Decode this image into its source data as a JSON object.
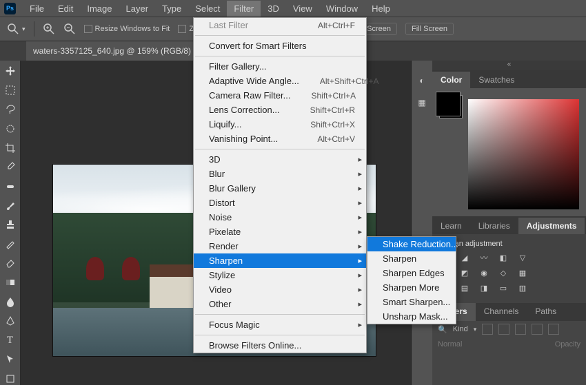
{
  "menubar": {
    "items": [
      "File",
      "Edit",
      "Image",
      "Layer",
      "Type",
      "Select",
      "Filter",
      "3D",
      "View",
      "Window",
      "Help"
    ],
    "active": "Filter"
  },
  "optionsBar": {
    "resizeWindows": "Resize Windows to Fit",
    "zoomAll": "Z",
    "fitScreen": "Screen",
    "fillScreen": "Fill Screen"
  },
  "document": {
    "tabTitle": "waters-3357125_640.jpg @ 159% (RGB/8)"
  },
  "filterMenu": {
    "lastFilter": {
      "label": "Last Filter",
      "shortcut": "Alt+Ctrl+F"
    },
    "convertSmart": "Convert for Smart Filters",
    "gallery": "Filter Gallery...",
    "adaptive": {
      "label": "Adaptive Wide Angle...",
      "shortcut": "Alt+Shift+Ctrl+A"
    },
    "cameraRaw": {
      "label": "Camera Raw Filter...",
      "shortcut": "Shift+Ctrl+A"
    },
    "lens": {
      "label": "Lens Correction...",
      "shortcut": "Shift+Ctrl+R"
    },
    "liquify": {
      "label": "Liquify...",
      "shortcut": "Shift+Ctrl+X"
    },
    "vanishing": {
      "label": "Vanishing Point...",
      "shortcut": "Alt+Ctrl+V"
    },
    "subs": [
      "3D",
      "Blur",
      "Blur Gallery",
      "Distort",
      "Noise",
      "Pixelate",
      "Render",
      "Sharpen",
      "Stylize",
      "Video",
      "Other"
    ],
    "focusMagic": "Focus Magic",
    "browse": "Browse Filters Online..."
  },
  "sharpenMenu": {
    "items": [
      "Shake Reduction...",
      "Sharpen",
      "Sharpen Edges",
      "Sharpen More",
      "Smart Sharpen...",
      "Unsharp Mask..."
    ],
    "highlighted": "Shake Reduction..."
  },
  "rightPanels": {
    "colorTabs": [
      "Color",
      "Swatches"
    ],
    "learnTabs": [
      "Learn",
      "Libraries",
      "Adjustments"
    ],
    "adjHeader": "Add an adjustment",
    "layerTabs": [
      "Layers",
      "Channels",
      "Paths"
    ],
    "kind": "Kind",
    "normal": "Normal",
    "opacity": "Opacity"
  }
}
